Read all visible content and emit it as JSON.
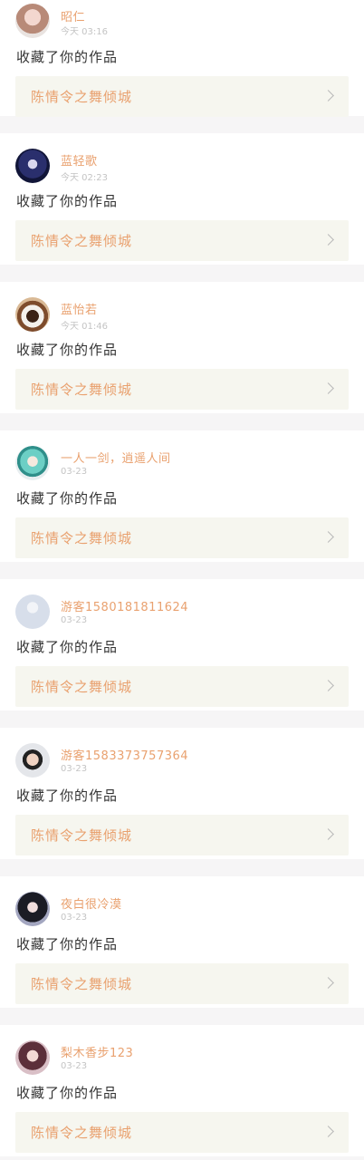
{
  "feed": {
    "items": [
      {
        "user": "昭仁",
        "time": "今天 03:16",
        "action": "收藏了你的作品",
        "work": "陈情令之舞倾城",
        "avatar": "avatar-girl-portrait"
      },
      {
        "user": "蓝轻歌",
        "time": "今天 02:23",
        "action": "收藏了你的作品",
        "work": "陈情令之舞倾城",
        "avatar": "avatar-anime-character"
      },
      {
        "user": "蓝怡若",
        "time": "今天 01:46",
        "action": "收藏了你的作品",
        "work": "陈情令之舞倾城",
        "avatar": "avatar-coffee-cup"
      },
      {
        "user": "一人一剑，逍遥人间",
        "time": "03-23",
        "action": "收藏了你的作品",
        "work": "陈情令之舞倾城",
        "avatar": "avatar-anime-green-hair"
      },
      {
        "user": "游客1580181811624",
        "time": "03-23",
        "action": "收藏了你的作品",
        "work": "陈情令之舞倾城",
        "avatar": "avatar-default"
      },
      {
        "user": "游客1583373757364",
        "time": "03-23",
        "action": "收藏了你的作品",
        "work": "陈情令之舞倾城",
        "avatar": "avatar-boy-portrait"
      },
      {
        "user": "夜白很冷漠",
        "time": "03-23",
        "action": "收藏了你的作品",
        "work": "陈情令之舞倾城",
        "avatar": "avatar-girl-dark"
      },
      {
        "user": "梨木香步123",
        "time": "03-23",
        "action": "收藏了你的作品",
        "work": "陈情令之舞倾城",
        "avatar": "avatar-anime-girl"
      }
    ]
  },
  "colors": {
    "accent": "#e9a16f",
    "text": "#333333",
    "muted": "#c4c4c4",
    "link_bg": "#f6f6ef",
    "page_bg": "#f6f5f6"
  }
}
